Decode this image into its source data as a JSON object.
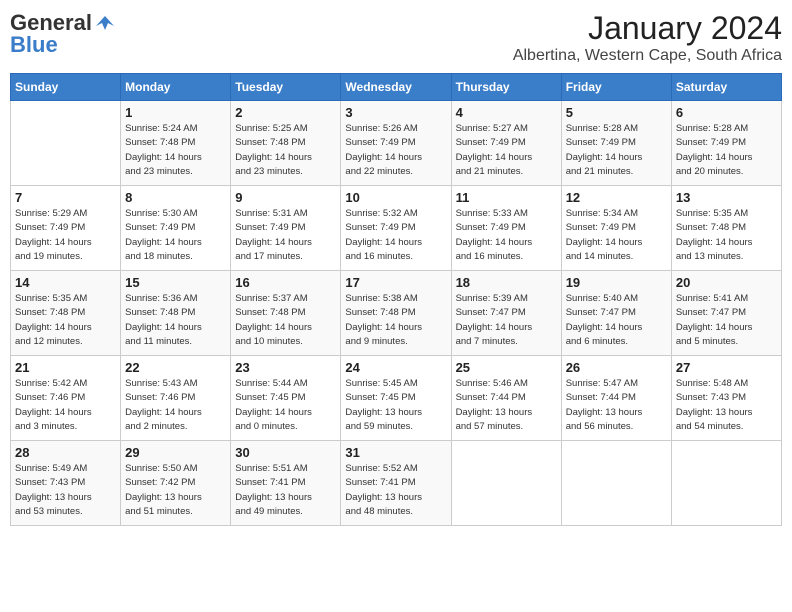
{
  "header": {
    "logo_line1": "General",
    "logo_line2": "Blue",
    "month": "January 2024",
    "location": "Albertina, Western Cape, South Africa"
  },
  "days_of_week": [
    "Sunday",
    "Monday",
    "Tuesday",
    "Wednesday",
    "Thursday",
    "Friday",
    "Saturday"
  ],
  "weeks": [
    [
      {
        "day": "",
        "info": ""
      },
      {
        "day": "1",
        "info": "Sunrise: 5:24 AM\nSunset: 7:48 PM\nDaylight: 14 hours\nand 23 minutes."
      },
      {
        "day": "2",
        "info": "Sunrise: 5:25 AM\nSunset: 7:48 PM\nDaylight: 14 hours\nand 23 minutes."
      },
      {
        "day": "3",
        "info": "Sunrise: 5:26 AM\nSunset: 7:49 PM\nDaylight: 14 hours\nand 22 minutes."
      },
      {
        "day": "4",
        "info": "Sunrise: 5:27 AM\nSunset: 7:49 PM\nDaylight: 14 hours\nand 21 minutes."
      },
      {
        "day": "5",
        "info": "Sunrise: 5:28 AM\nSunset: 7:49 PM\nDaylight: 14 hours\nand 21 minutes."
      },
      {
        "day": "6",
        "info": "Sunrise: 5:28 AM\nSunset: 7:49 PM\nDaylight: 14 hours\nand 20 minutes."
      }
    ],
    [
      {
        "day": "7",
        "info": "Sunrise: 5:29 AM\nSunset: 7:49 PM\nDaylight: 14 hours\nand 19 minutes."
      },
      {
        "day": "8",
        "info": "Sunrise: 5:30 AM\nSunset: 7:49 PM\nDaylight: 14 hours\nand 18 minutes."
      },
      {
        "day": "9",
        "info": "Sunrise: 5:31 AM\nSunset: 7:49 PM\nDaylight: 14 hours\nand 17 minutes."
      },
      {
        "day": "10",
        "info": "Sunrise: 5:32 AM\nSunset: 7:49 PM\nDaylight: 14 hours\nand 16 minutes."
      },
      {
        "day": "11",
        "info": "Sunrise: 5:33 AM\nSunset: 7:49 PM\nDaylight: 14 hours\nand 16 minutes."
      },
      {
        "day": "12",
        "info": "Sunrise: 5:34 AM\nSunset: 7:49 PM\nDaylight: 14 hours\nand 14 minutes."
      },
      {
        "day": "13",
        "info": "Sunrise: 5:35 AM\nSunset: 7:48 PM\nDaylight: 14 hours\nand 13 minutes."
      }
    ],
    [
      {
        "day": "14",
        "info": "Sunrise: 5:35 AM\nSunset: 7:48 PM\nDaylight: 14 hours\nand 12 minutes."
      },
      {
        "day": "15",
        "info": "Sunrise: 5:36 AM\nSunset: 7:48 PM\nDaylight: 14 hours\nand 11 minutes."
      },
      {
        "day": "16",
        "info": "Sunrise: 5:37 AM\nSunset: 7:48 PM\nDaylight: 14 hours\nand 10 minutes."
      },
      {
        "day": "17",
        "info": "Sunrise: 5:38 AM\nSunset: 7:48 PM\nDaylight: 14 hours\nand 9 minutes."
      },
      {
        "day": "18",
        "info": "Sunrise: 5:39 AM\nSunset: 7:47 PM\nDaylight: 14 hours\nand 7 minutes."
      },
      {
        "day": "19",
        "info": "Sunrise: 5:40 AM\nSunset: 7:47 PM\nDaylight: 14 hours\nand 6 minutes."
      },
      {
        "day": "20",
        "info": "Sunrise: 5:41 AM\nSunset: 7:47 PM\nDaylight: 14 hours\nand 5 minutes."
      }
    ],
    [
      {
        "day": "21",
        "info": "Sunrise: 5:42 AM\nSunset: 7:46 PM\nDaylight: 14 hours\nand 3 minutes."
      },
      {
        "day": "22",
        "info": "Sunrise: 5:43 AM\nSunset: 7:46 PM\nDaylight: 14 hours\nand 2 minutes."
      },
      {
        "day": "23",
        "info": "Sunrise: 5:44 AM\nSunset: 7:45 PM\nDaylight: 14 hours\nand 0 minutes."
      },
      {
        "day": "24",
        "info": "Sunrise: 5:45 AM\nSunset: 7:45 PM\nDaylight: 13 hours\nand 59 minutes."
      },
      {
        "day": "25",
        "info": "Sunrise: 5:46 AM\nSunset: 7:44 PM\nDaylight: 13 hours\nand 57 minutes."
      },
      {
        "day": "26",
        "info": "Sunrise: 5:47 AM\nSunset: 7:44 PM\nDaylight: 13 hours\nand 56 minutes."
      },
      {
        "day": "27",
        "info": "Sunrise: 5:48 AM\nSunset: 7:43 PM\nDaylight: 13 hours\nand 54 minutes."
      }
    ],
    [
      {
        "day": "28",
        "info": "Sunrise: 5:49 AM\nSunset: 7:43 PM\nDaylight: 13 hours\nand 53 minutes."
      },
      {
        "day": "29",
        "info": "Sunrise: 5:50 AM\nSunset: 7:42 PM\nDaylight: 13 hours\nand 51 minutes."
      },
      {
        "day": "30",
        "info": "Sunrise: 5:51 AM\nSunset: 7:41 PM\nDaylight: 13 hours\nand 49 minutes."
      },
      {
        "day": "31",
        "info": "Sunrise: 5:52 AM\nSunset: 7:41 PM\nDaylight: 13 hours\nand 48 minutes."
      },
      {
        "day": "",
        "info": ""
      },
      {
        "day": "",
        "info": ""
      },
      {
        "day": "",
        "info": ""
      }
    ]
  ]
}
